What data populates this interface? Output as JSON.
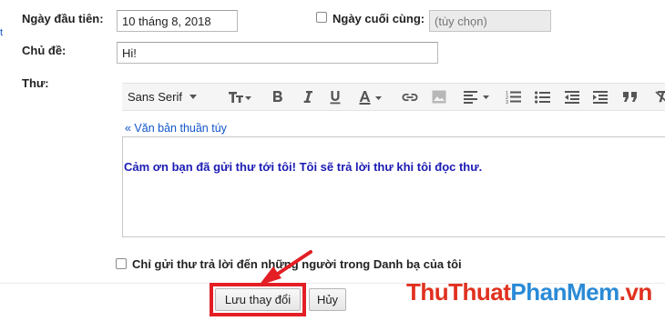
{
  "form": {
    "start_date_label": "Ngày đầu tiên:",
    "start_date_value": "10 tháng 8, 2018",
    "end_date_label": "Ngày cuối cùng:",
    "end_date_placeholder": "(tùy chọn)",
    "subject_label": "Chủ đề:",
    "subject_value": "Hi!",
    "message_label": "Thư:",
    "edge_mark": "t"
  },
  "toolbar": {
    "font_family": "Sans Serif",
    "buttons": [
      "text-size",
      "bold",
      "italic",
      "underline",
      "text-color",
      "link",
      "image",
      "align",
      "numbered-list",
      "bulleted-list",
      "indent-less",
      "indent-more",
      "quote",
      "remove-formatting"
    ]
  },
  "editor": {
    "plain_text_link": "« Văn bản thuần túy",
    "body_text": "Cảm ơn bạn đã gửi thư tới tôi! Tôi sẽ trả lời thư khi tôi đọc thư."
  },
  "contacts_only_label": "Chỉ gửi thư trả lời đến những người trong Danh bạ của tôi",
  "buttons": {
    "save": "Lưu thay đổi",
    "cancel": "Hủy"
  },
  "colors": {
    "highlight": "#e31e24",
    "editor_text": "#1b1bb3",
    "link": "#1155cc"
  },
  "watermark": {
    "part1": "ThuThuat",
    "part2": "PhanMem",
    "part3": ".vn"
  }
}
